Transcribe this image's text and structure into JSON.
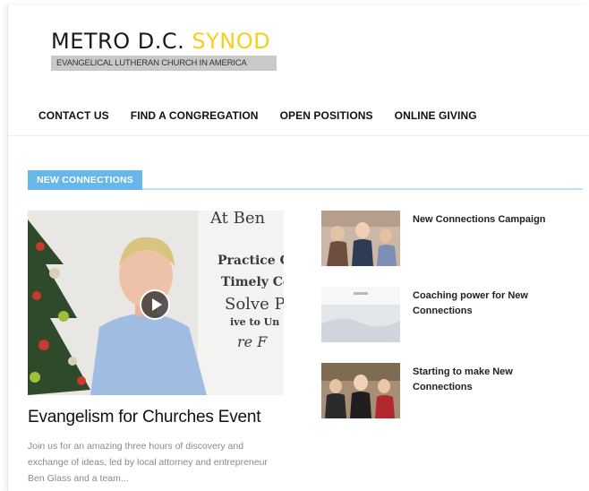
{
  "logo": {
    "main_prefix": "METRO D.C.",
    "main_accent": "SYNOD",
    "subtitle": "EVANGELICAL LUTHERAN CHURCH IN AMERICA",
    "accent_color": "#f5cf1a"
  },
  "nav": {
    "items": [
      {
        "label": "CONTACT US"
      },
      {
        "label": "FIND A CONGREGATION"
      },
      {
        "label": "OPEN POSITIONS"
      },
      {
        "label": "ONLINE GIVING"
      }
    ]
  },
  "section": {
    "tab_label": "NEW CONNECTIONS",
    "tab_color": "#69b7e8"
  },
  "feature": {
    "title": "Evangelism for Churches Event",
    "description": "Join us for an amazing three hours of discovery and exchange of ideas, led by local attorney and entrepreneur Ben Glass and a team...",
    "board_lines": [
      "At Ben",
      "Practice C",
      "Timely Co",
      "Solve P",
      "ive to Un",
      "re F"
    ],
    "play_icon": "play-icon"
  },
  "sidebar": {
    "items": [
      {
        "title": "New Connections Campaign"
      },
      {
        "title": "Coaching power for New Connections"
      },
      {
        "title": "Starting to make New Connections"
      }
    ]
  }
}
